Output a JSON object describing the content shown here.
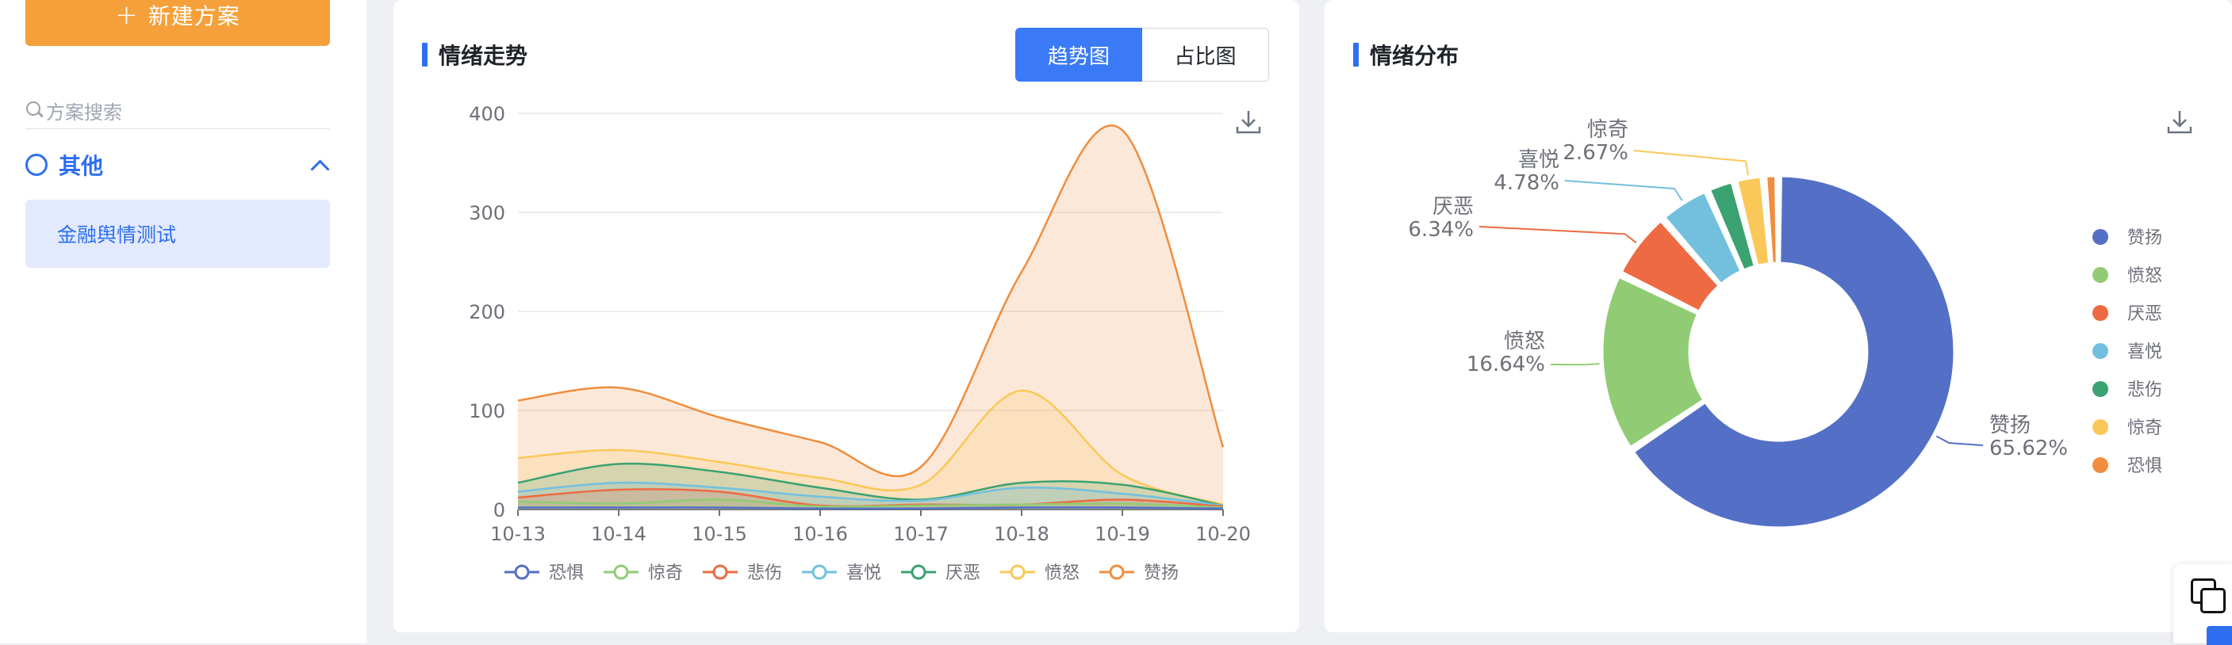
{
  "sidebar": {
    "new_button_label": "新建方案",
    "search_placeholder": "方案搜索",
    "group_label": "其他",
    "items": [
      {
        "label": "金融舆情测试"
      }
    ]
  },
  "trend_card": {
    "title": "情绪走势",
    "tabs": [
      {
        "label": "趋势图",
        "active": true
      },
      {
        "label": "占比图",
        "active": false
      }
    ]
  },
  "dist_card": {
    "title": "情绪分布"
  },
  "colors": {
    "accent": "#2d6ff0",
    "new_button": "#f5a03a",
    "active_tab": "#3a7af6"
  },
  "icons": [
    "plus-icon",
    "search-icon",
    "circle-icon",
    "chevron-up-icon",
    "download-icon",
    "copy-icon"
  ],
  "chart_data": [
    {
      "type": "area",
      "x": [
        "10-13",
        "10-14",
        "10-15",
        "10-16",
        "10-17",
        "10-18",
        "10-19",
        "10-20"
      ],
      "ylim": [
        0,
        400
      ],
      "yticks": [
        0,
        100,
        200,
        300,
        400
      ],
      "grid": true,
      "legend_placement": "bottom",
      "series": [
        {
          "name": "恐惧",
          "color": "#5470c6",
          "values": [
            2,
            2,
            2,
            1,
            1,
            2,
            2,
            1
          ]
        },
        {
          "name": "惊奇",
          "color": "#91cc75",
          "values": [
            8,
            6,
            10,
            3,
            4,
            5,
            6,
            2
          ]
        },
        {
          "name": "悲伤",
          "color": "#ee6a42",
          "values": [
            12,
            20,
            18,
            4,
            5,
            5,
            10,
            3
          ]
        },
        {
          "name": "喜悦",
          "color": "#73c0de",
          "values": [
            18,
            27,
            22,
            13,
            9,
            22,
            16,
            4
          ]
        },
        {
          "name": "厌恶",
          "color": "#3ba272",
          "values": [
            27,
            46,
            38,
            22,
            10,
            27,
            25,
            4
          ]
        },
        {
          "name": "愤怒",
          "color": "#fac858",
          "values": [
            52,
            60,
            48,
            32,
            25,
            120,
            35,
            5
          ]
        },
        {
          "name": "赞扬",
          "color": "#f08d3e",
          "values": [
            110,
            123,
            93,
            68,
            43,
            240,
            383,
            63
          ]
        }
      ]
    },
    {
      "type": "pie",
      "donut": true,
      "legend_placement": "right",
      "slices": [
        {
          "name": "赞扬",
          "percent": 65.62,
          "label": "赞扬\n65.62%",
          "color": "#5470c6"
        },
        {
          "name": "愤怒",
          "percent": 16.64,
          "label": "愤怒\n16.64%",
          "color": "#91cc75"
        },
        {
          "name": "厌恶",
          "percent": 6.34,
          "label": "厌恶\n6.34%",
          "color": "#ee6a42"
        },
        {
          "name": "喜悦",
          "percent": 4.78,
          "label": "喜悦\n4.78%",
          "color": "#73c0de"
        },
        {
          "name": "悲伤",
          "percent": 2.6,
          "label": "",
          "color": "#3ba272"
        },
        {
          "name": "惊奇",
          "percent": 2.67,
          "label": "惊奇\n2.67%",
          "color": "#fac858"
        },
        {
          "name": "恐惧",
          "percent": 1.35,
          "label": "",
          "color": "#f08d3e"
        }
      ]
    }
  ]
}
